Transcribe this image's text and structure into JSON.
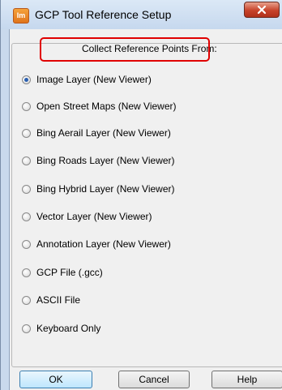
{
  "window": {
    "title": "GCP Tool Reference Setup",
    "app_icon_text": "Im"
  },
  "group": {
    "title": "Collect Reference Points From:",
    "options": [
      {
        "label": "Image Layer (New Viewer)",
        "checked": true
      },
      {
        "label": "Open Street Maps (New Viewer)",
        "checked": false
      },
      {
        "label": "Bing Aerail Layer (New Viewer)",
        "checked": false
      },
      {
        "label": "Bing Roads Layer (New Viewer)",
        "checked": false
      },
      {
        "label": "Bing Hybrid Layer (New Viewer)",
        "checked": false
      },
      {
        "label": "Vector Layer (New Viewer)",
        "checked": false
      },
      {
        "label": "Annotation Layer (New Viewer)",
        "checked": false
      },
      {
        "label": "GCP File (.gcc)",
        "checked": false
      },
      {
        "label": "ASCII File",
        "checked": false
      },
      {
        "label": "Keyboard Only",
        "checked": false
      }
    ]
  },
  "buttons": {
    "ok": "OK",
    "cancel": "Cancel",
    "help": "Help"
  },
  "colors": {
    "highlight": "#e00000",
    "radio_selected": "#2a5fb0"
  }
}
